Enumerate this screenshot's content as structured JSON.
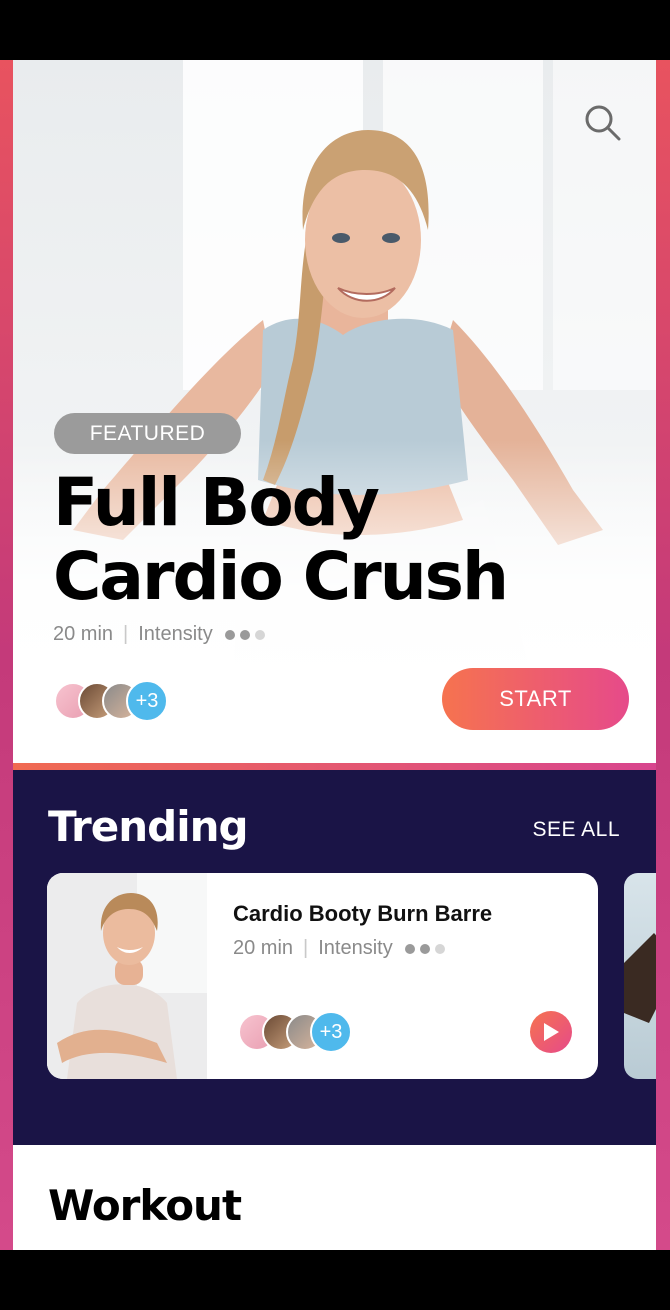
{
  "hero": {
    "badge": "FEATURED",
    "title_line1": "Full Body",
    "title_line2": "Cardio Crush",
    "duration": "20 min",
    "intensity_label": "Intensity",
    "intensity_level": 2,
    "intensity_max": 3,
    "participants_extra": "+3",
    "start_label": "START"
  },
  "trending": {
    "title": "Trending",
    "see_all_label": "SEE ALL",
    "cards": [
      {
        "title": "Cardio Booty Burn Barre",
        "duration": "20 min",
        "intensity_label": "Intensity",
        "intensity_level": 2,
        "intensity_max": 3,
        "participants_extra": "+3"
      }
    ]
  },
  "workout": {
    "title": "Workout"
  },
  "colors": {
    "accent_start": "#f6734f",
    "accent_end": "#e64a8a",
    "trending_bg": "#1a1446",
    "avatar_count_bg": "#4fb9ec",
    "badge_bg": "#9b9b9b"
  },
  "icons": {
    "search": "search-icon",
    "play": "play-icon"
  }
}
